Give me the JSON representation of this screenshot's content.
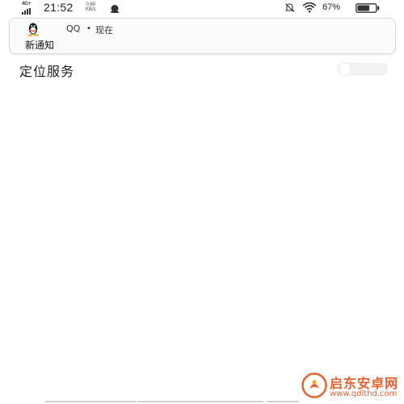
{
  "status_bar": {
    "network": "4G+",
    "time": "21:52",
    "speed_value": "0.60",
    "speed_unit": "KB/s",
    "battery_percent": "67%",
    "icons": [
      "signal-icon",
      "qq-status-icon",
      "mute-icon",
      "wifi-icon",
      "battery-icon"
    ],
    "battery_level": 0.67
  },
  "notification": {
    "app_name": "QQ",
    "separator": "•",
    "time": "现在",
    "message": "新通知",
    "icon": "qq-penguin-icon"
  },
  "settings": {
    "location_label": "定位服务",
    "location_enabled": false
  },
  "watermark": {
    "name": "启东安卓网",
    "url": "www.qdlthd.com"
  },
  "colors": {
    "background": "#ffffff",
    "watermark": "#e8622f",
    "toggle_off": "#f2f2f2"
  }
}
